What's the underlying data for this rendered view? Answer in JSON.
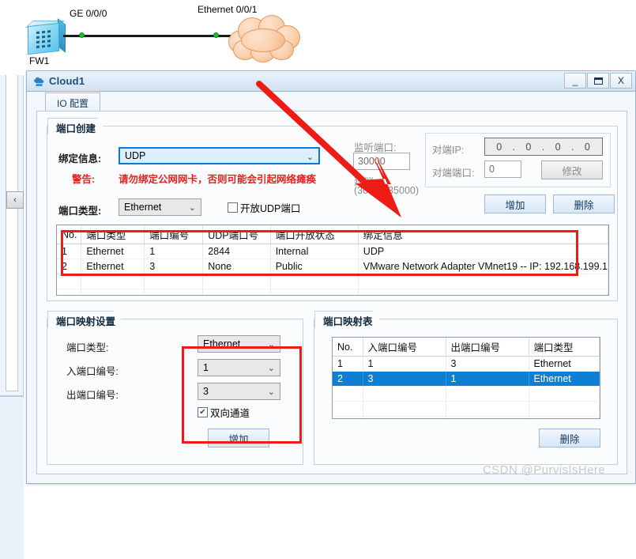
{
  "topology": {
    "device_label": "FW1",
    "left_interface": "GE 0/0/0",
    "right_interface": "Ethernet 0/0/1"
  },
  "rail": {
    "collapse_icon": "‹"
  },
  "window": {
    "title": "Cloud1",
    "icon": "cloud-device-icon",
    "minimize": "_",
    "maximize": "❐",
    "close": "X"
  },
  "tabs": [
    {
      "label": "IO 配置"
    }
  ],
  "port_create": {
    "group_title": "端口创建",
    "binding_label": "绑定信息:",
    "binding_value": "UDP",
    "warning_label": "警告:",
    "warning_text": "请勿绑定公网网卡，否则可能会引起网络瘫痪",
    "port_type_label": "端口类型:",
    "port_type_value": "Ethernet",
    "open_udp_label": "开放UDP端口",
    "open_udp_checked": false,
    "listen_port_label": "监听端口:",
    "listen_port_value": "30000",
    "suggest_label": "建议:",
    "suggest_range": "(30000-35000)",
    "peer_ip_label": "对端IP:",
    "peer_ip_octets": [
      "0",
      "0",
      "0",
      "0"
    ],
    "peer_port_label": "对端端口:",
    "peer_port_value": "0",
    "modify_button": "修改",
    "add_button": "增加",
    "delete_button": "删除"
  },
  "port_table": {
    "columns": [
      "No.",
      "端口类型",
      "端口编号",
      "UDP端口号",
      "端口开放状态",
      "绑定信息"
    ],
    "rows": [
      [
        "1",
        "Ethernet",
        "1",
        "2844",
        "Internal",
        "UDP"
      ],
      [
        "2",
        "Ethernet",
        "3",
        "None",
        "Public",
        "VMware Network Adapter VMnet19 -- IP: 192.168.199.1"
      ]
    ],
    "empty_rows": 5
  },
  "mapping_settings": {
    "group_title": "端口映射设置",
    "port_type_label": "端口类型:",
    "port_type_value": "Ethernet",
    "in_port_label": "入端口编号:",
    "in_port_value": "1",
    "out_port_label": "出端口编号:",
    "out_port_value": "3",
    "bidirectional_label": "双向通道",
    "bidirectional_checked": true,
    "add_button": "增加"
  },
  "mapping_table": {
    "group_title": "端口映射表",
    "columns": [
      "No.",
      "入端口编号",
      "出端口编号",
      "端口类型"
    ],
    "rows": [
      {
        "cells": [
          "1",
          "1",
          "3",
          "Ethernet"
        ],
        "selected": false
      },
      {
        "cells": [
          "2",
          "3",
          "1",
          "Ethernet"
        ],
        "selected": true
      }
    ],
    "empty_rows": 3,
    "delete_button": "删除"
  },
  "watermark": "CSDN @PurvisIsHere",
  "colors": {
    "accent": "#0f7fd4",
    "annotation": "#ee1c16",
    "warning": "#e8201b",
    "title": "#1f4e79"
  }
}
